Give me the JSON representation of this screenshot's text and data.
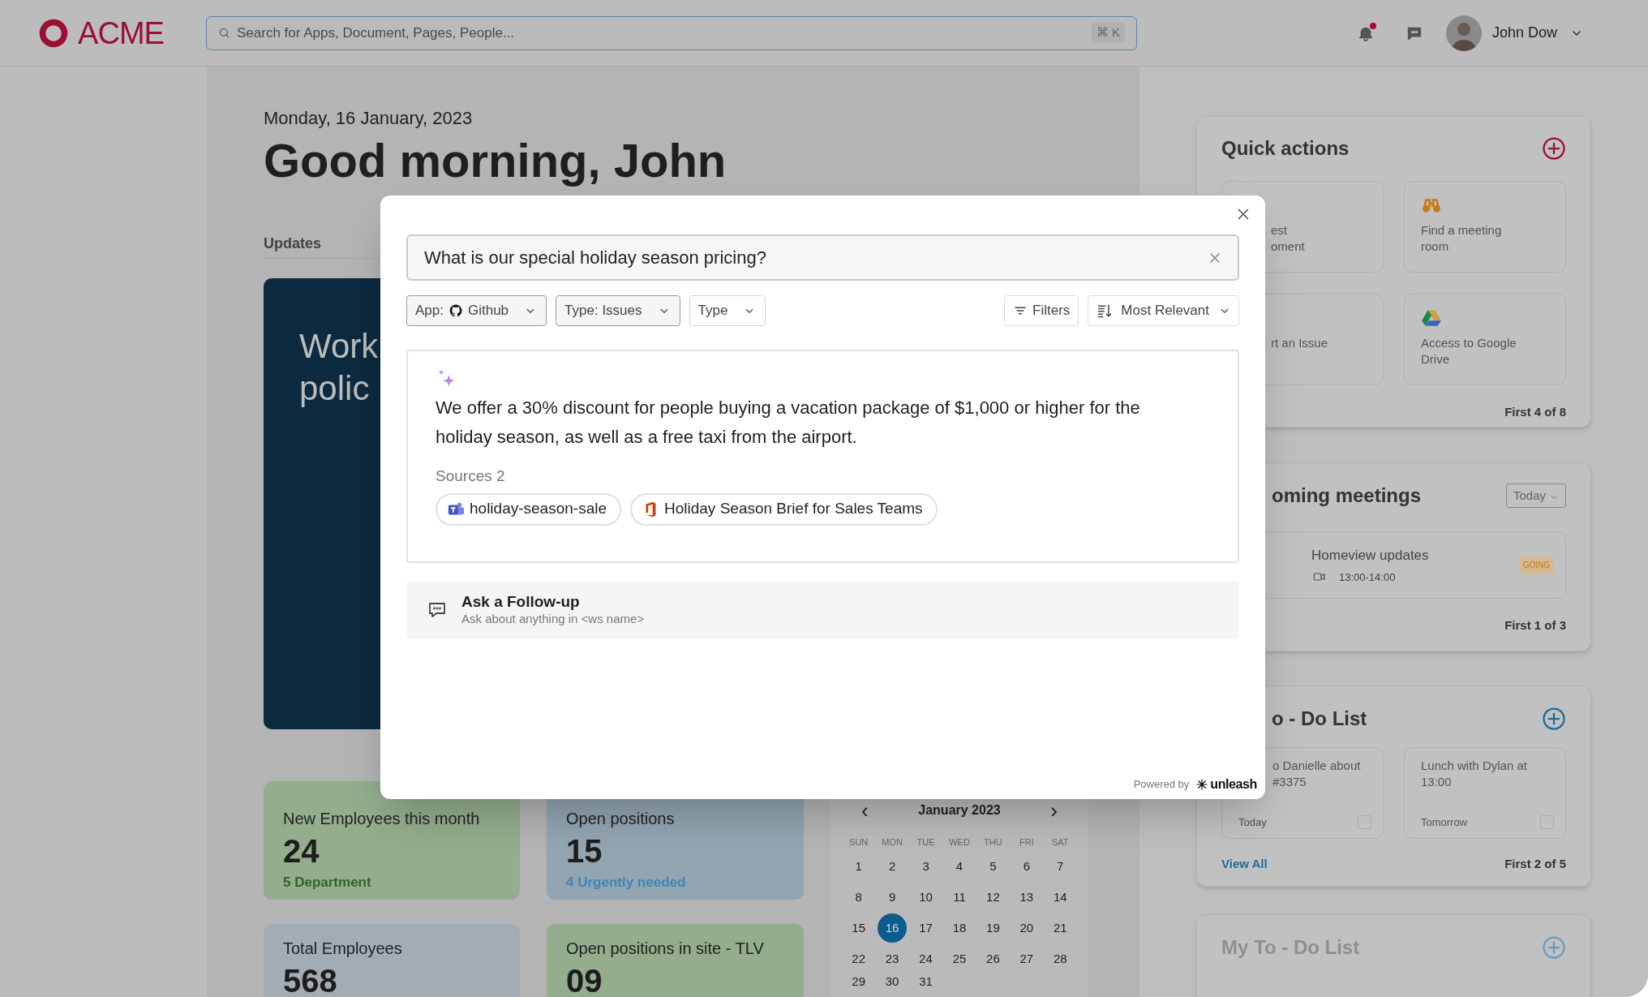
{
  "header": {
    "logo": "ACME",
    "search": {
      "placeholder": "Search for Apps, Document, Pages, People...",
      "shortcut": "⌘ K"
    },
    "notifications": {
      "unread": true
    },
    "user": {
      "name": "John Dow"
    }
  },
  "greeting": {
    "date": "Monday, 16 January, 2023",
    "title": "Good morning, John"
  },
  "updates": {
    "label": "Updates",
    "card_lines": [
      "Work",
      "polic"
    ]
  },
  "stats": [
    {
      "kind": "green",
      "title": "New Employees this month",
      "value": "24",
      "note": "5 Department"
    },
    {
      "kind": "blue",
      "title": "Open positions",
      "value": "15",
      "note": "4 Urgently needed"
    },
    {
      "kind": "slate",
      "title": "Total Employees",
      "value": "568"
    },
    {
      "kind": "green",
      "title": "Open positions in site - TLV",
      "value": "09"
    }
  ],
  "calendar": {
    "month": "January 2023",
    "prev": "‹",
    "next": "›",
    "weekdays": [
      "SUN",
      "MON",
      "TUE",
      "WED",
      "THU",
      "FRI",
      "SAT"
    ],
    "days": [
      {
        "label": "1",
        "selected": false
      },
      {
        "label": "2",
        "selected": false
      },
      {
        "label": "3",
        "selected": false
      },
      {
        "label": "4",
        "selected": false
      },
      {
        "label": "5",
        "selected": false
      },
      {
        "label": "6",
        "selected": false
      },
      {
        "label": "7",
        "selected": false
      },
      {
        "label": "8",
        "selected": false
      },
      {
        "label": "9",
        "selected": false
      },
      {
        "label": "10",
        "selected": false
      },
      {
        "label": "11",
        "selected": false
      },
      {
        "label": "12",
        "selected": false
      },
      {
        "label": "13",
        "selected": false
      },
      {
        "label": "14",
        "selected": false
      },
      {
        "label": "15",
        "selected": false
      },
      {
        "label": "16",
        "selected": true
      },
      {
        "label": "17",
        "selected": false
      },
      {
        "label": "18",
        "selected": false
      },
      {
        "label": "19",
        "selected": false
      },
      {
        "label": "20",
        "selected": false
      },
      {
        "label": "21",
        "selected": false
      },
      {
        "label": "22",
        "selected": false
      },
      {
        "label": "23",
        "selected": false
      },
      {
        "label": "24",
        "selected": false
      },
      {
        "label": "25",
        "selected": false
      },
      {
        "label": "26",
        "selected": false
      },
      {
        "label": "27",
        "selected": false
      },
      {
        "label": "28",
        "selected": false
      },
      {
        "label": "29",
        "selected": false
      },
      {
        "label": "30",
        "selected": false
      },
      {
        "label": "31",
        "selected": false
      }
    ]
  },
  "quick_actions": {
    "title": "Quick actions",
    "tiles": [
      {
        "kind": "covered",
        "lines": [
          "est",
          "oment"
        ]
      },
      {
        "kind": "open",
        "lines": [
          "Find a meeting",
          "room"
        ]
      },
      {
        "kind": "covered",
        "lines": [
          "rt an Issue"
        ]
      },
      {
        "kind": "open",
        "lines": [
          "Access to Google",
          "Drive"
        ]
      }
    ],
    "footer": "First 4 of 8"
  },
  "meetings": {
    "title": "oming meetings",
    "filter": "Today",
    "items": [
      {
        "title": "Homeview updates",
        "time": "13:00-14:00",
        "status": "GOING"
      }
    ],
    "footer": "First 1 of 3"
  },
  "todo": {
    "title": "o - Do List",
    "items": [
      {
        "kind": "covered",
        "lines": [
          "o Danielle about",
          "#3375"
        ],
        "due": "Today",
        "checked": false
      },
      {
        "kind": "open",
        "lines": [
          "Lunch with Dylan at",
          "13:00"
        ],
        "due": "Tomorrow",
        "checked": false
      }
    ],
    "view_all": "View All",
    "footer": "First 2 of 5"
  },
  "my_todo": {
    "title": "My To - Do List"
  },
  "modal": {
    "query": "What is our special holiday season pricing?",
    "filters": [
      {
        "kind": "app",
        "label": "App:",
        "value": "Github",
        "active": true
      },
      {
        "kind": "select",
        "label": "Type: Issues",
        "active": true
      },
      {
        "kind": "select",
        "label": "Type",
        "active": false
      }
    ],
    "filters_button": "Filters",
    "sort": "Most Relevant",
    "answer": "We offer a 30% discount for people buying a vacation package of $1,000 or higher for the holiday season, as well as a free taxi from the airport.",
    "sources_label": "Sources 2",
    "sources": [
      {
        "title": "holiday-season-sale"
      },
      {
        "title": "Holiday Season Brief for Sales Teams"
      }
    ],
    "follow_up": {
      "title": "Ask a Follow-up",
      "subtitle": "Ask about anything in <ws name>"
    },
    "powered_by": "Powered by",
    "brand": "unleash"
  }
}
